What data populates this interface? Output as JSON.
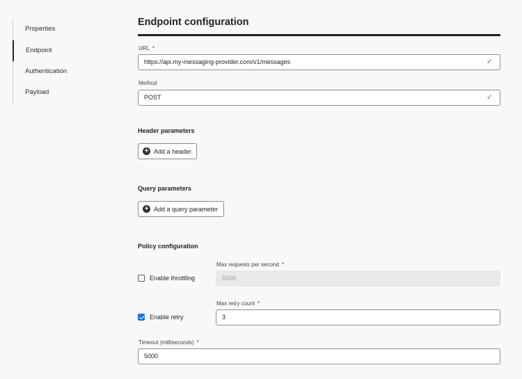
{
  "sidebar": {
    "items": [
      {
        "label": "Properties",
        "active": false
      },
      {
        "label": "Endpoint",
        "active": true
      },
      {
        "label": "Authentication",
        "active": false
      },
      {
        "label": "Payload",
        "active": false
      }
    ]
  },
  "main": {
    "title": "Endpoint configuration",
    "required_marker": "*",
    "url": {
      "label": "URL",
      "value": "https://api.my-messaging-provider.com/v1/messages",
      "valid_icon": "✓"
    },
    "method": {
      "label": "Method",
      "value": "POST",
      "valid_icon": "✓"
    },
    "header_params": {
      "heading": "Header parameters",
      "button_label": "Add a header"
    },
    "query_params": {
      "heading": "Query parameters",
      "button_label": "Add a query parameter"
    },
    "policy": {
      "heading": "Policy configuration",
      "throttling": {
        "checkbox_label": "Enable throttling",
        "checked": false,
        "field_label": "Max requests per second",
        "value": "5000"
      },
      "retry": {
        "checkbox_label": "Enable retry",
        "checked": true,
        "field_label": "Max retry count",
        "value": "3"
      },
      "timeout": {
        "label": "Timeout (milliseconds)",
        "value": "5000"
      }
    }
  },
  "colors": {
    "accent": "#1473e6",
    "valid": "#2d9d78",
    "title_rule": "#222222"
  }
}
